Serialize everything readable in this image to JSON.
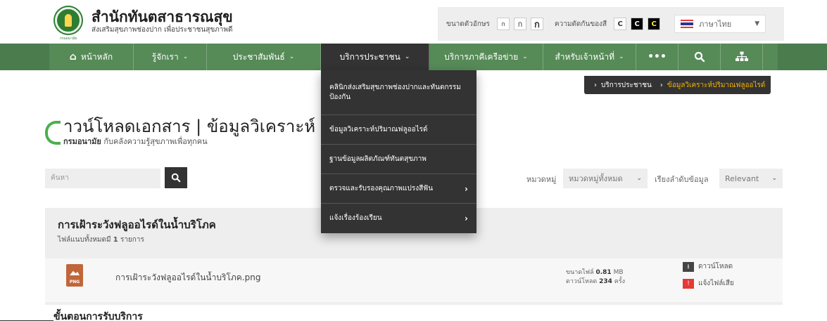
{
  "header": {
    "site_title": "สำนักทันตสาธารณสุข",
    "tagline": "ส่งเสริมสุขภาพช่องปาก เพื่อประชาชนสุขภาพดี",
    "logo_text": "กรมอนามัย",
    "util": {
      "font_label": "ขนาดตัวอักษร",
      "font_buttons": [
        "ก",
        "ก",
        "ก"
      ],
      "contrast_label": "ความตัดกันของสี",
      "contrast_buttons": [
        "C",
        "C",
        "C"
      ],
      "language": "ภาษาไทย"
    }
  },
  "nav": {
    "items": [
      {
        "label": "หน้าหลัก",
        "icon": "home-icon"
      },
      {
        "label": "รู้จักเรา"
      },
      {
        "label": "ประชาสัมพันธ์"
      },
      {
        "label": "บริการประชาชน"
      },
      {
        "label": "บริการภาคีเครือข่าย"
      },
      {
        "label": "สำหรับเจ้าหน้าที่"
      }
    ],
    "more_icon": "more-icon",
    "search_icon": "search-icon",
    "sitemap_icon": "sitemap-icon"
  },
  "dropdown": [
    {
      "label": "คลินิกส่งเสริมสุขภาพช่องปากและทันตกรรมป้องกัน",
      "has_sub": false
    },
    {
      "label": "ข้อมูลวิเคราะห์ปริมาณฟลูออไรด์",
      "has_sub": false
    },
    {
      "label": "ฐานข้อมูลผลิตภัณฑ์ทันตสุขภาพ",
      "has_sub": false
    },
    {
      "label": "ตรวจและรับรองคุณภาพแปรงสีฟัน",
      "has_sub": true
    },
    {
      "label": "แจ้งเรื่องร้องเรียน",
      "has_sub": true
    }
  ],
  "breadcrumb": {
    "items": [
      "บริการประชาชน",
      "ข้อมูลวิเคราะห์ปริมาณฟลูออไรด์"
    ]
  },
  "page": {
    "title": "าวน์โหลดเอกสาร | ข้อมูลวิเคราะห์",
    "subtitle_strong": "กรมอนามัย",
    "subtitle_rest": " กับคลังความรู้สุขภาพเพื่อทุกคน"
  },
  "search": {
    "placeholder": "ค้นหา"
  },
  "filters": {
    "category_label": "หมวดหมู่",
    "category_value": "หมวดหมู่ทั้งหมด",
    "sort_label": "เรียงลำดับข้อมูล",
    "sort_value": "Relevant"
  },
  "section": {
    "title": "การเฝ้าระวังฟลูออไรด์ในน้ำบริโภค",
    "count_prefix": "ไฟล์แนบทั้งหมดมี ",
    "count": "1",
    "count_suffix": " รายการ",
    "file": {
      "ext": "PNG",
      "name": "การเฝ้าระวังฟลูออไรด์ในน้ำบริโภค.png",
      "size_label": "ขนาดไฟล์ ",
      "size_value": "0.81",
      "size_unit": " MB",
      "downloads_label": "ดาวน์โหลด ",
      "downloads_value": "234",
      "downloads_unit": " ครั้ง",
      "download_text": "ดาวน์โหลด",
      "report_text": "แจ้งไฟล์เสีย"
    }
  },
  "next_section": "ขั้นตอนการรับบริการ"
}
